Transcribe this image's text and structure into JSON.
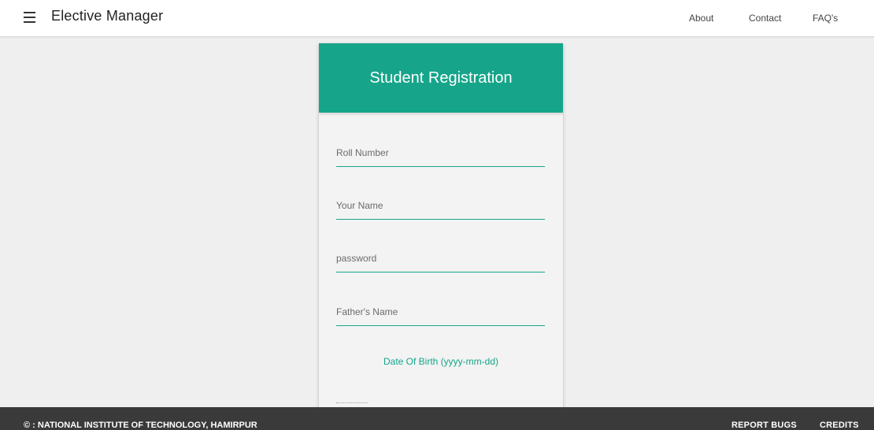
{
  "navbar": {
    "menu_icon": "hamburger-menu-icon",
    "brand": "Elective Manager",
    "links": [
      "About",
      "Contact",
      "FAQ's"
    ]
  },
  "form": {
    "title": "Student Registration",
    "fields": {
      "roll_number": {
        "placeholder": "Roll Number",
        "value": ""
      },
      "name": {
        "placeholder": "Your Name",
        "value": ""
      },
      "password": {
        "placeholder": "password",
        "value": ""
      },
      "father_name": {
        "placeholder": "Father's Name",
        "value": ""
      }
    },
    "dob_label": "Date Of Birth (yyyy-mm-dd)"
  },
  "footer": {
    "copyright": "© : NATIONAL INSTITUTE OF TECHNOLOGY, HAMIRPUR",
    "report_bugs": "REPORT BUGS",
    "credits": "CREDITS"
  },
  "colors": {
    "accent": "#16a58a",
    "footer_bg": "#3a3a3a",
    "page_bg": "#efefef"
  }
}
